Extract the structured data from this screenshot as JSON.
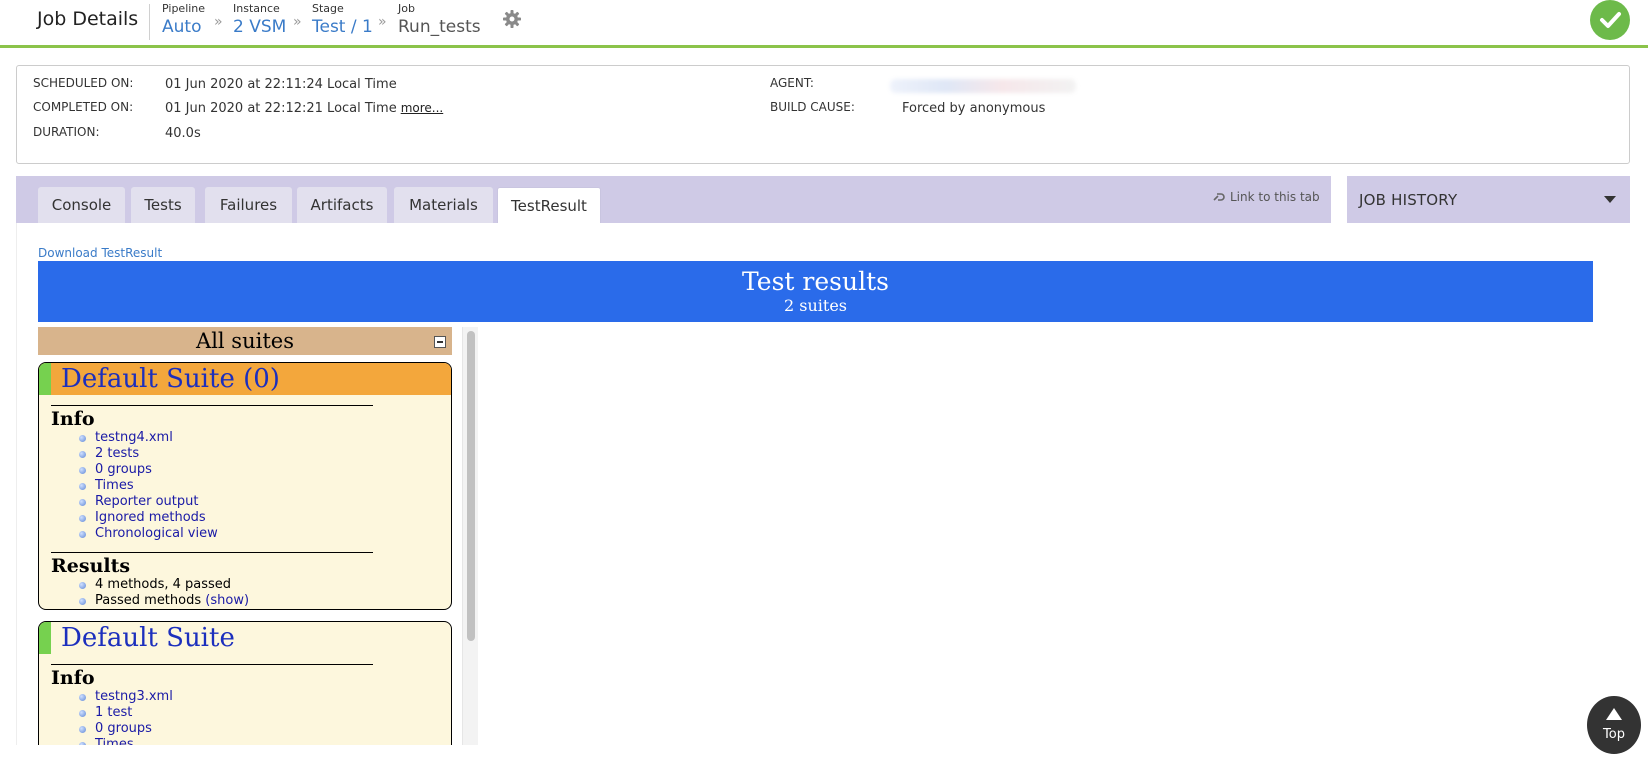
{
  "header": {
    "title": "Job Details",
    "breadcrumbs": [
      {
        "label": "Pipeline",
        "value": "Auto"
      },
      {
        "label": "Instance",
        "value": "2 VSM"
      },
      {
        "label": "Stage",
        "value": "Test / 1"
      },
      {
        "label": "Job",
        "value": "Run_tests"
      }
    ],
    "chevron": "»",
    "settings_icon": "gear-icon",
    "status_icon": "check-circle-icon",
    "status_color": "#6dba4a"
  },
  "info": {
    "scheduled_label": "SCHEDULED ON:",
    "scheduled_value": "01 Jun 2020 at 22:11:24 Local Time",
    "completed_label": "COMPLETED ON:",
    "completed_value": "01 Jun 2020 at 22:12:21 Local Time",
    "more_link": "more...",
    "duration_label": "DURATION:",
    "duration_value": "40.0s",
    "agent_label": "AGENT:",
    "build_cause_label": "BUILD CAUSE:",
    "build_cause_value": "Forced by anonymous"
  },
  "tabs": [
    {
      "label": "Console"
    },
    {
      "label": "Tests"
    },
    {
      "label": "Failures"
    },
    {
      "label": "Artifacts"
    },
    {
      "label": "Materials"
    },
    {
      "label": "TestResult",
      "active": true
    }
  ],
  "link_to_tab": "Link to this tab",
  "job_history": "JOB HISTORY",
  "download_link": "Download TestResult",
  "report": {
    "title": "Test results",
    "subtitle": "2 suites",
    "banner_color": "#2a6bea",
    "all_suites": "All suites",
    "suites": [
      {
        "name": "Default Suite (0)",
        "header_color": "#f3a73c",
        "info_title": "Info",
        "info_items": [
          "testng4.xml",
          "2 tests",
          "0 groups",
          "Times",
          "Reporter output",
          "Ignored methods",
          "Chronological view"
        ],
        "results_title": "Results",
        "results_summary": "4 methods, 4 passed",
        "passed_methods": "Passed methods",
        "show_link": "(show)"
      },
      {
        "name": "Default Suite",
        "info_title": "Info",
        "info_items": [
          "testng3.xml",
          "1 test",
          "0 groups",
          "Times"
        ]
      }
    ]
  },
  "top_button": "Top"
}
